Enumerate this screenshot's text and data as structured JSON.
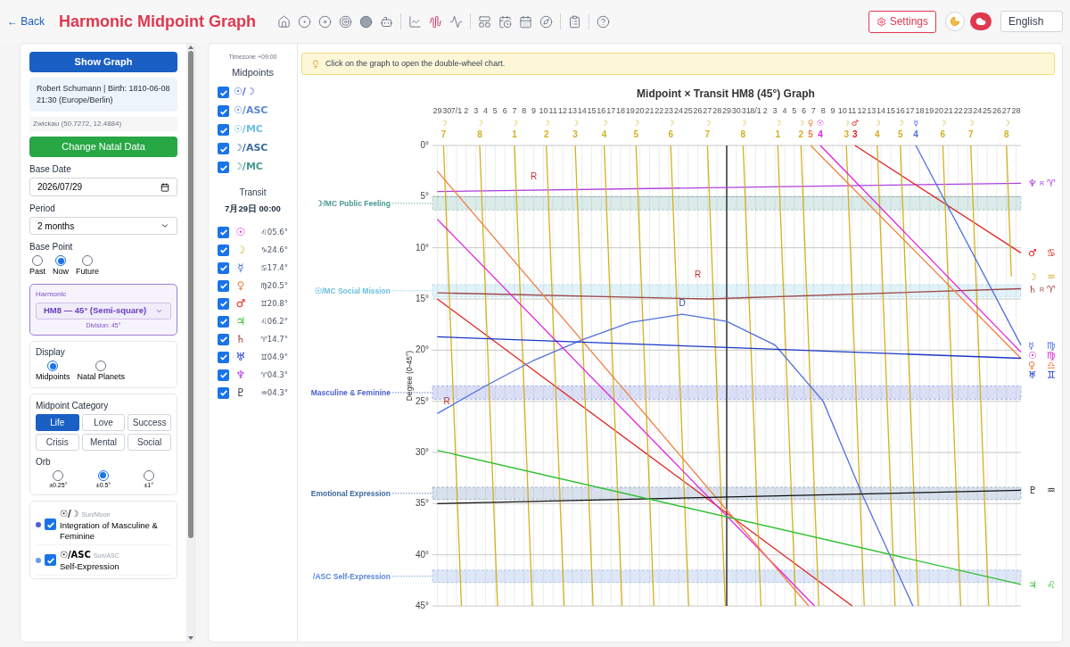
{
  "header": {
    "back": "← Back",
    "title": "Harmonic Midpoint Graph",
    "settings": "Settings",
    "language": "English"
  },
  "sidebar": {
    "show_graph": "Show Graph",
    "person": "Robert Schumann | Birth: 1810-06-08 21:30 (Europe/Berlin)",
    "location": "Zwickau (50.7272, 12.4884)",
    "change_button": "Change Natal Data",
    "base_date": {
      "label": "Base Date",
      "value": "2026/07/29"
    },
    "period": {
      "label": "Period",
      "value": "2 months"
    },
    "base_point": {
      "label": "Base Point",
      "options": [
        {
          "label": "Past",
          "selected": false
        },
        {
          "label": "Now",
          "selected": true
        },
        {
          "label": "Future",
          "selected": false
        }
      ]
    },
    "harmonic": {
      "label": "Harmonic",
      "value": "HM8 — 45° (Semi-square)",
      "note": "Division: 45°"
    },
    "display": {
      "label": "Display",
      "options": [
        {
          "label": "Midpoints",
          "selected": true
        },
        {
          "label": "Natal Planets",
          "selected": false
        }
      ]
    },
    "category": {
      "label": "Midpoint Category",
      "options": [
        {
          "label": "Life",
          "selected": true
        },
        {
          "label": "Love",
          "selected": false
        },
        {
          "label": "Success",
          "selected": false
        },
        {
          "label": "Crisis",
          "selected": false
        },
        {
          "label": "Mental",
          "selected": false
        },
        {
          "label": "Social",
          "selected": false
        }
      ]
    },
    "orb": {
      "label": "Orb",
      "options": [
        {
          "label": "±0.25°",
          "selected": false
        },
        {
          "label": "±0.5°",
          "selected": true
        },
        {
          "label": "±1°",
          "selected": false
        }
      ]
    },
    "midpoint_items": [
      {
        "glyph": "☉/☽",
        "name": "Sun/Moon",
        "description": "Integration of Masculine & Feminine",
        "color": "#4a5fd0",
        "checked": true
      },
      {
        "glyph": "☉/ASC",
        "name": "Sun/ASC",
        "description": "Self-Expression",
        "color": "#6a9ae8",
        "checked": true
      }
    ]
  },
  "panel": {
    "timezone": "Timezone +09:00",
    "midpoints_title": "Midpoints",
    "midpoints": [
      {
        "label": "☉/☽",
        "color": "#4a5fd0",
        "checked": true
      },
      {
        "label": "☉/ASC",
        "color": "#5a86d8",
        "checked": true
      },
      {
        "label": "☉/MC",
        "color": "#6cc0e0",
        "checked": true
      },
      {
        "label": "☽/ASC",
        "color": "#3a6aa0",
        "checked": true
      },
      {
        "label": "☽/MC",
        "color": "#4a9a90",
        "checked": true
      }
    ],
    "transit_title": "Transit",
    "transit_time": "7月29日 00:00",
    "planets": [
      {
        "glyph": "☉",
        "position": "♌05.6°",
        "checked": true
      },
      {
        "glyph": "☽",
        "position": "♑24.6°",
        "checked": true
      },
      {
        "glyph": "☿",
        "position": "♋17.4°",
        "checked": true
      },
      {
        "glyph": "♀",
        "position": "♍20.5°",
        "checked": true
      },
      {
        "glyph": "♂",
        "position": "♊20.8°",
        "checked": true
      },
      {
        "glyph": "♃",
        "position": "♌06.2°",
        "checked": true
      },
      {
        "glyph": "♄",
        "position": "♈14.7°",
        "checked": true
      },
      {
        "glyph": "♅",
        "position": "♊04.9°",
        "checked": true
      },
      {
        "glyph": "♆",
        "position": "♈04.3°",
        "checked": true
      },
      {
        "glyph": "♇",
        "position": "♒04.3°",
        "checked": true
      }
    ]
  },
  "notice": "Click on the graph to open the double-wheel chart.",
  "graph": {
    "title": "Midpoint × Transit  HM8 (45°) Graph",
    "ylabel": "Degree (0-45°)",
    "yticks": [
      "0°",
      "5°",
      "10°",
      "15°",
      "20°",
      "25°",
      "30°",
      "35°",
      "40°",
      "45°"
    ],
    "date_labels": [
      "29",
      "30",
      "7/1",
      "2",
      "3",
      "4",
      "5",
      "6",
      "7",
      "8",
      "9",
      "10",
      "11",
      "12",
      "13",
      "14",
      "15",
      "16",
      "17",
      "18",
      "19",
      "20",
      "21",
      "22",
      "23",
      "24",
      "25",
      "26",
      "27",
      "28",
      "29",
      "30",
      "31",
      "8/1",
      "2",
      "3",
      "4",
      "5",
      "6",
      "7",
      "8",
      "9",
      "10",
      "11",
      "12",
      "13",
      "14",
      "15",
      "16",
      "17",
      "18",
      "19",
      "20",
      "21",
      "22",
      "23",
      "24",
      "25",
      "26",
      "27",
      "28"
    ],
    "bands": [
      {
        "label": "☽/MC Public Feeling",
        "color": "#4a9a90"
      },
      {
        "label": "☉/MC Social Mission",
        "color": "#6cc0e0"
      },
      {
        "label": "Masculine & Feminine",
        "color": "#4a5fd0"
      },
      {
        "label": "Emotional Expression",
        "color": "#3a6aa0"
      },
      {
        "label": "/ASC Self-Expression",
        "color": "#5a86d8"
      }
    ],
    "top_markers": [
      {
        "glyph": "☽",
        "label": "7",
        "color": "#d4b020"
      },
      {
        "glyph": "☽",
        "label": "8",
        "color": "#d4b020"
      },
      {
        "glyph": "☽",
        "label": "1",
        "color": "#d4b020"
      },
      {
        "glyph": "☽",
        "label": "2",
        "color": "#d4b020"
      },
      {
        "glyph": "☽",
        "label": "3",
        "color": "#d4b020"
      },
      {
        "glyph": "☽",
        "label": "4",
        "color": "#d4b020"
      },
      {
        "glyph": "☽",
        "label": "5",
        "color": "#d4b020"
      },
      {
        "glyph": "☽",
        "label": "6",
        "color": "#d4b020"
      },
      {
        "glyph": "☽",
        "label": "7",
        "color": "#d4b020"
      },
      {
        "glyph": "☽",
        "label": "8",
        "color": "#d4b020"
      },
      {
        "glyph": "☽",
        "label": "1",
        "color": "#d4b020"
      },
      {
        "glyph": "☽",
        "label": "2",
        "color": "#d4b020"
      },
      {
        "glyph": "♀",
        "label": "5",
        "color": "#f08040"
      },
      {
        "glyph": "☉",
        "label": "4",
        "color": "#e020e0"
      },
      {
        "glyph": "☽",
        "label": "3",
        "color": "#d4b020"
      },
      {
        "glyph": "♂",
        "label": "3",
        "color": "#e02020"
      },
      {
        "glyph": "☽",
        "label": "4",
        "color": "#d4b020"
      },
      {
        "glyph": "☽",
        "label": "5",
        "color": "#d4b020"
      },
      {
        "glyph": "☿",
        "label": "4",
        "color": "#5070e0"
      },
      {
        "glyph": "☽",
        "label": "6",
        "color": "#d4b020"
      },
      {
        "glyph": "☽",
        "label": "7",
        "color": "#d4b020"
      },
      {
        "glyph": "☽",
        "label": "8",
        "color": "#d4b020"
      }
    ],
    "notes": [
      "R",
      "R",
      "D",
      "R"
    ],
    "end_labels": [
      {
        "glyph": "♆",
        "retro": "R",
        "sign": "♈"
      },
      {
        "glyph": "♂",
        "sign": "♋"
      },
      {
        "glyph": "☽",
        "sign": "♒"
      },
      {
        "glyph": "♄",
        "retro": "R",
        "sign": "♈"
      },
      {
        "glyph": "☿",
        "sign": "♍"
      },
      {
        "glyph": "☉",
        "sign": "♍"
      },
      {
        "glyph": "♀",
        "sign": "♎"
      },
      {
        "glyph": "♅",
        "sign": "♊"
      },
      {
        "glyph": "♇",
        "sign": "♒"
      },
      {
        "glyph": "♃",
        "sign": "♌"
      }
    ]
  }
}
